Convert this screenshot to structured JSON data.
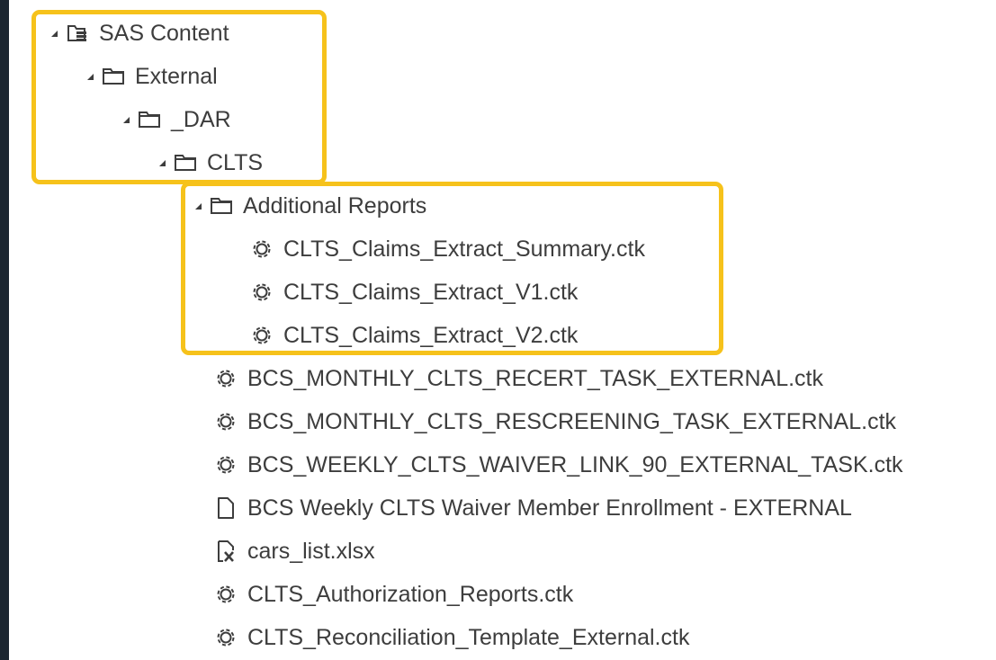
{
  "colors": {
    "highlight": "#f6c21b",
    "text": "#3d3d3d",
    "icon": "#3d3d3d",
    "background": "#1b2530"
  },
  "tree": {
    "root": {
      "label": "SAS Content",
      "icon": "sas-content-icon",
      "expanded": true
    },
    "external": {
      "label": "External",
      "icon": "folder-icon",
      "expanded": true
    },
    "dar": {
      "label": "_DAR",
      "icon": "folder-icon",
      "expanded": true
    },
    "clts": {
      "label": "CLTS",
      "icon": "folder-icon",
      "expanded": true
    },
    "additional_reports": {
      "label": "Additional Reports",
      "icon": "folder-icon",
      "expanded": true
    },
    "additional_items": [
      {
        "label": "CLTS_Claims_Extract_Summary.ctk",
        "icon": "gear-icon"
      },
      {
        "label": "CLTS_Claims_Extract_V1.ctk",
        "icon": "gear-icon"
      },
      {
        "label": "CLTS_Claims_Extract_V2.ctk",
        "icon": "gear-icon"
      }
    ],
    "clts_items": [
      {
        "label": "BCS_MONTHLY_CLTS_RECERT_TASK_EXTERNAL.ctk",
        "icon": "gear-icon"
      },
      {
        "label": "BCS_MONTHLY_CLTS_RESCREENING_TASK_EXTERNAL.ctk",
        "icon": "gear-icon"
      },
      {
        "label": "BCS_WEEKLY_CLTS_WAIVER_LINK_90_EXTERNAL_TASK.ctk",
        "icon": "gear-icon"
      },
      {
        "label": "BCS Weekly CLTS Waiver Member Enrollment - EXTERNAL",
        "icon": "document-icon"
      },
      {
        "label": "cars_list.xlsx",
        "icon": "excel-file-icon"
      },
      {
        "label": "CLTS_Authorization_Reports.ctk",
        "icon": "gear-icon"
      },
      {
        "label": "CLTS_Reconciliation_Template_External.ctk",
        "icon": "gear-icon"
      }
    ]
  }
}
